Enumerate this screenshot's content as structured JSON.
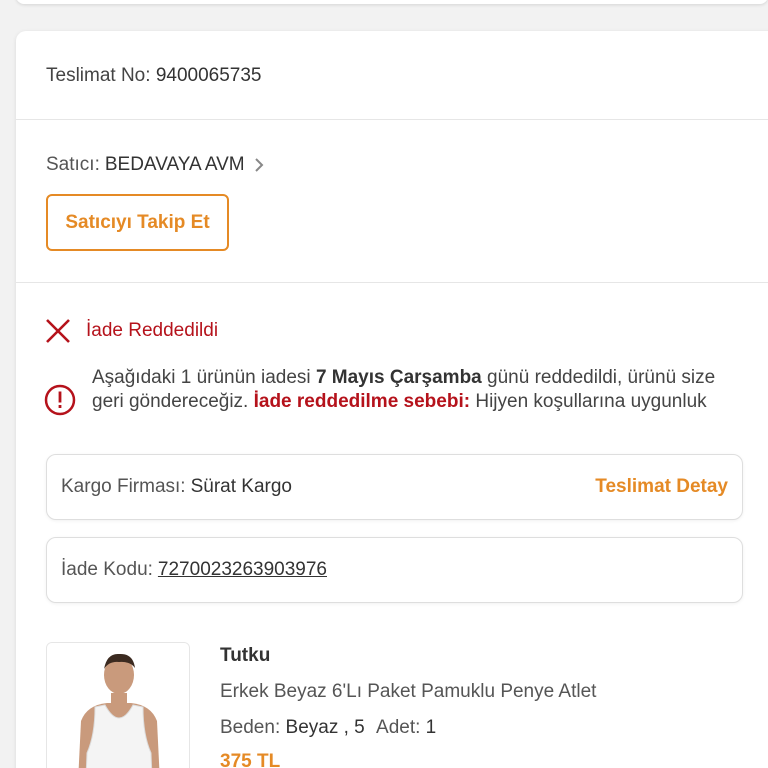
{
  "delivery": {
    "label": "Teslimat No:",
    "number": "9400065735"
  },
  "seller": {
    "label": "Satıcı:",
    "name": "BEDAVAYA AVM",
    "follow_label": "Satıcıyı Takip Et"
  },
  "status": {
    "text": "İade Reddedildi",
    "color": "#b5121b"
  },
  "info": {
    "part1": "Aşağıdaki 1 ürünün iadesi ",
    "date": "7 Mayıs Çarşamba",
    "part2": " günü reddedildi, ürünü size geri göndereceğiz. ",
    "reason_label": "İade reddedilme sebebi:",
    "reason": " Hijyen koşullarına uygunluk"
  },
  "cargo": {
    "label": "Kargo Firması:",
    "company": "Sürat Kargo",
    "detail_link": "Teslimat Detay"
  },
  "return_code": {
    "label": "İade Kodu:",
    "code": "7270023263903976"
  },
  "product": {
    "brand": "Tutku",
    "name": "Erkek Beyaz 6'Lı Paket Pamuklu Penye Atlet",
    "size_label": "Beden:",
    "size_value": "Beyaz , 5",
    "qty_label": "Adet:",
    "qty_value": "1",
    "price": "375 TL"
  },
  "colors": {
    "accent": "#e58a25",
    "danger": "#b5121b"
  },
  "icons": [
    "chevron-right-icon",
    "close-x-icon",
    "info-circle-icon"
  ]
}
